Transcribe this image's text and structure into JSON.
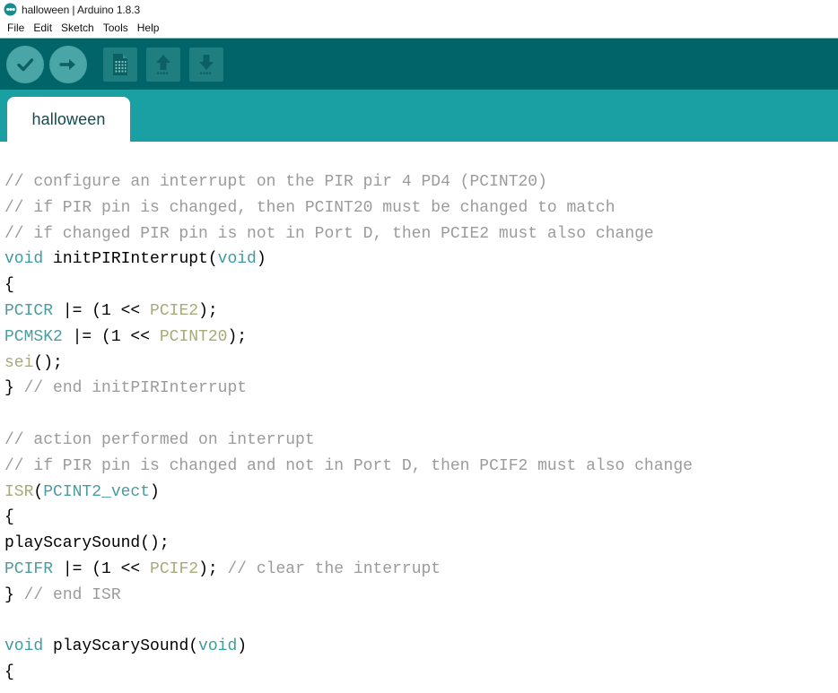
{
  "window": {
    "title": "halloween | Arduino 1.8.3",
    "logo_icon": "arduino-infinity-icon"
  },
  "menubar": {
    "items": [
      {
        "label": "File"
      },
      {
        "label": "Edit"
      },
      {
        "label": "Sketch"
      },
      {
        "label": "Tools"
      },
      {
        "label": "Help"
      }
    ]
  },
  "toolbar": {
    "background": "#006468",
    "buttons": [
      {
        "name": "verify-button",
        "icon": "checkmark-icon",
        "tooltip": "Verify"
      },
      {
        "name": "upload-button",
        "icon": "arrow-right-icon",
        "tooltip": "Upload"
      },
      {
        "name": "new-button",
        "icon": "new-document-icon",
        "tooltip": "New"
      },
      {
        "name": "open-button",
        "icon": "arrow-up-icon",
        "tooltip": "Open"
      },
      {
        "name": "save-button",
        "icon": "arrow-down-icon",
        "tooltip": "Save"
      }
    ]
  },
  "tabs": {
    "background": "#1aa0a3",
    "items": [
      {
        "label": "halloween",
        "active": true
      }
    ]
  },
  "editor": {
    "background": "#ffffff",
    "colors": {
      "comment": "#9b9b9b",
      "keyword": "#3c9ca0",
      "register": "#4a9ca0",
      "constant": "#a9a97a",
      "plain": "#000000"
    },
    "lines": [
      [
        {
          "t": "// configure an interrupt on the PIR pir 4 PD4 (PCINT20)",
          "c": "comment"
        }
      ],
      [
        {
          "t": "// if PIR pin is changed, then PCINT20 must be changed to match",
          "c": "comment"
        }
      ],
      [
        {
          "t": "// if changed PIR pin is not in Port D, then PCIE2 must also change",
          "c": "comment"
        }
      ],
      [
        {
          "t": "void",
          "c": "kw"
        },
        {
          "t": " initPIRInterrupt(",
          "c": "plain"
        },
        {
          "t": "void",
          "c": "kw"
        },
        {
          "t": ")",
          "c": "plain"
        }
      ],
      [
        {
          "t": "{",
          "c": "plain"
        }
      ],
      [
        {
          "t": "PCICR",
          "c": "type"
        },
        {
          "t": " |= (1 << ",
          "c": "plain"
        },
        {
          "t": "PCIE2",
          "c": "lit"
        },
        {
          "t": ");",
          "c": "plain"
        }
      ],
      [
        {
          "t": "PCMSK2",
          "c": "type"
        },
        {
          "t": " |= (1 << ",
          "c": "plain"
        },
        {
          "t": "PCINT20",
          "c": "lit"
        },
        {
          "t": ");",
          "c": "plain"
        }
      ],
      [
        {
          "t": "sei",
          "c": "lit"
        },
        {
          "t": "();",
          "c": "plain"
        }
      ],
      [
        {
          "t": "} ",
          "c": "plain"
        },
        {
          "t": "// end initPIRInterrupt",
          "c": "comment"
        }
      ],
      [
        {
          "t": "",
          "c": "plain"
        }
      ],
      [
        {
          "t": "// action performed on interrupt",
          "c": "comment"
        }
      ],
      [
        {
          "t": "// if PIR pin is changed and not in Port D, then PCIF2 must also change",
          "c": "comment"
        }
      ],
      [
        {
          "t": "ISR",
          "c": "lit"
        },
        {
          "t": "(",
          "c": "plain"
        },
        {
          "t": "PCINT2_vect",
          "c": "type"
        },
        {
          "t": ")",
          "c": "plain"
        }
      ],
      [
        {
          "t": "{",
          "c": "plain"
        }
      ],
      [
        {
          "t": "playScarySound();",
          "c": "plain"
        }
      ],
      [
        {
          "t": "PCIFR",
          "c": "type"
        },
        {
          "t": " |= (1 << ",
          "c": "plain"
        },
        {
          "t": "PCIF2",
          "c": "lit"
        },
        {
          "t": "); ",
          "c": "plain"
        },
        {
          "t": "// clear the interrupt",
          "c": "comment"
        }
      ],
      [
        {
          "t": "} ",
          "c": "plain"
        },
        {
          "t": "// end ISR",
          "c": "comment"
        }
      ],
      [
        {
          "t": "",
          "c": "plain"
        }
      ],
      [
        {
          "t": "void",
          "c": "kw"
        },
        {
          "t": " playScarySound(",
          "c": "plain"
        },
        {
          "t": "void",
          "c": "kw"
        },
        {
          "t": ")",
          "c": "plain"
        }
      ],
      [
        {
          "t": "{",
          "c": "plain"
        }
      ]
    ]
  }
}
